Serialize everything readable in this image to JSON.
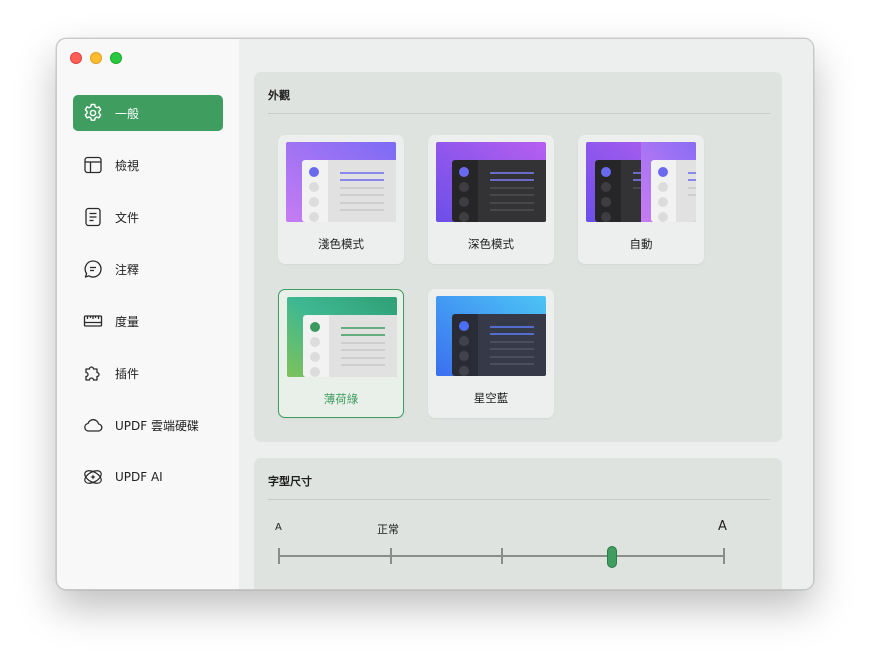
{
  "window": {
    "controls": [
      "close",
      "minimize",
      "zoom"
    ]
  },
  "sidebar": {
    "items": [
      {
        "label": "一般",
        "icon": "gear-icon",
        "active": true
      },
      {
        "label": "檢視",
        "icon": "layout-icon",
        "active": false
      },
      {
        "label": "文件",
        "icon": "document-icon",
        "active": false
      },
      {
        "label": "注釋",
        "icon": "comment-icon",
        "active": false
      },
      {
        "label": "度量",
        "icon": "ruler-icon",
        "active": false
      },
      {
        "label": "插件",
        "icon": "puzzle-icon",
        "active": false
      },
      {
        "label": "UPDF 雲端硬碟",
        "icon": "cloud-icon",
        "active": false
      },
      {
        "label": "UPDF AI",
        "icon": "ai-icon",
        "active": false
      }
    ]
  },
  "appearance": {
    "title": "外觀",
    "themes": [
      {
        "label": "淺色模式",
        "selected": false
      },
      {
        "label": "深色模式",
        "selected": false
      },
      {
        "label": "自動",
        "selected": false
      },
      {
        "label": "薄荷綠",
        "selected": true
      },
      {
        "label": "星空藍",
        "selected": false
      }
    ]
  },
  "font_size": {
    "title": "字型尺寸",
    "small_label": "A",
    "normal_label": "正常",
    "large_label": "A",
    "steps": 5,
    "value_index": 3
  },
  "colors": {
    "accent": "#3f9d5f",
    "panel": "#dfe3e0"
  }
}
